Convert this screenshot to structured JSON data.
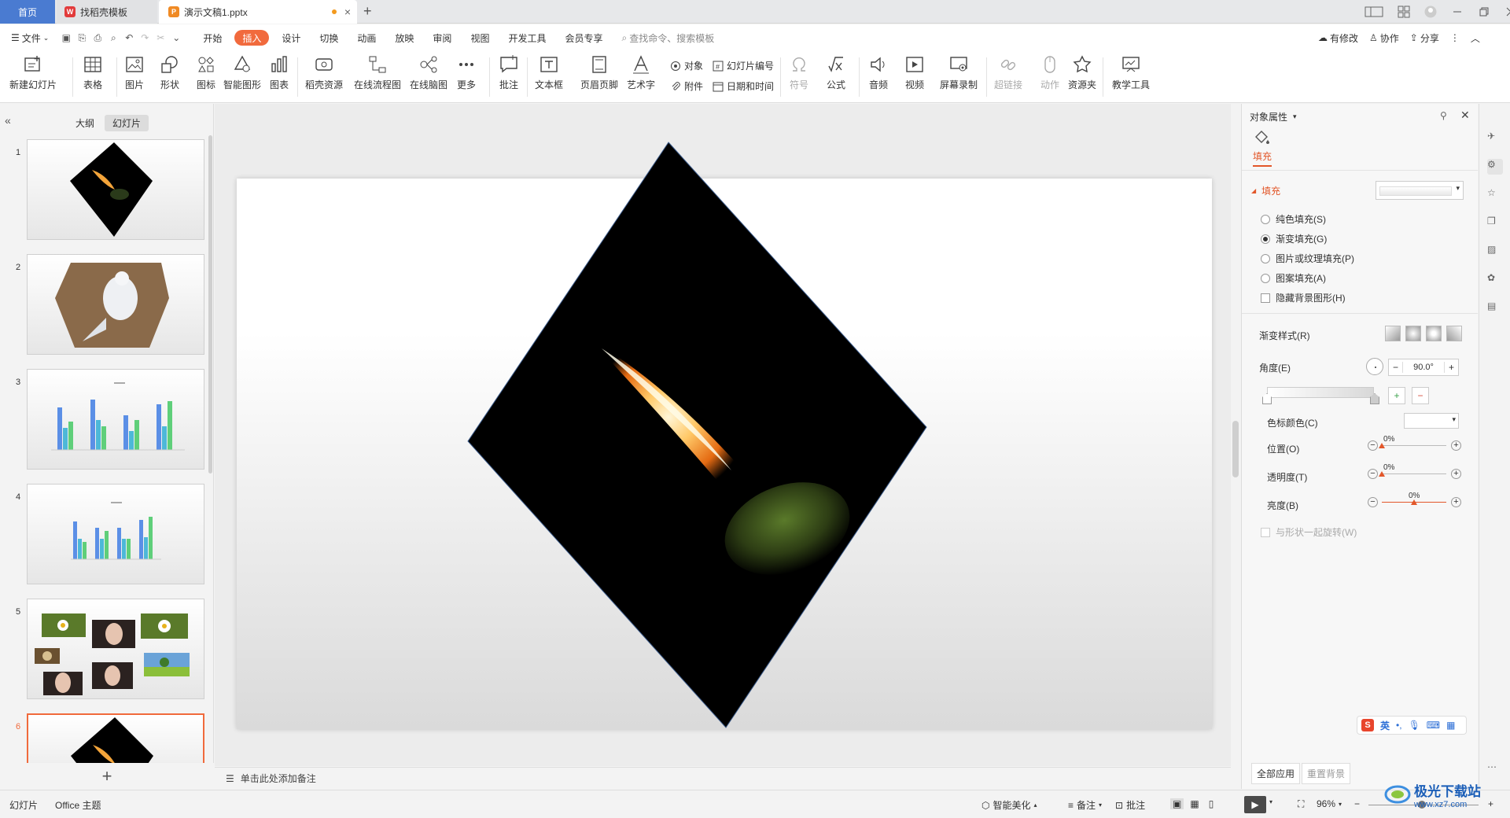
{
  "titlebar": {
    "tabs": [
      {
        "label": "首页"
      },
      {
        "label": "找稻壳模板"
      },
      {
        "label": "演示文稿1.pptx"
      }
    ]
  },
  "menubar": {
    "file": "文件",
    "items": [
      "开始",
      "插入",
      "设计",
      "切换",
      "动画",
      "放映",
      "审阅",
      "视图",
      "开发工具",
      "会员专享"
    ],
    "active": "插入",
    "search_placeholder": "查找命令、搜索模板",
    "right": {
      "modified": "有修改",
      "collab": "协作",
      "share": "分享"
    }
  },
  "ribbon": {
    "new_slide": "新建幻灯片",
    "table": "表格",
    "picture": "图片",
    "shape": "形状",
    "icon": "图标",
    "smartart": "智能图形",
    "chart": "图表",
    "docer": "稻壳资源",
    "flowchart": "在线流程图",
    "mindmap": "在线脑图",
    "more": "更多",
    "comment": "批注",
    "textbox": "文本框",
    "header_footer": "页眉页脚",
    "wordart": "艺术字",
    "object": "对象",
    "slide_number": "幻灯片编号",
    "attachment": "附件",
    "datetime": "日期和时间",
    "symbol": "符号",
    "formula": "公式",
    "audio": "音频",
    "video": "视频",
    "screen_record": "屏幕录制",
    "hyperlink": "超链接",
    "action": "动作",
    "resource": "资源夹",
    "teaching": "教学工具"
  },
  "leftpanel": {
    "tab_outline": "大纲",
    "tab_slides": "幻灯片",
    "slide_numbers": [
      "1",
      "2",
      "3",
      "4",
      "5",
      "6"
    ],
    "selected_slide": 6
  },
  "notes": {
    "placeholder": "单击此处添加备注"
  },
  "rightpanel": {
    "title": "对象属性",
    "tab_fill": "填充",
    "section_fill": "填充",
    "options": [
      "纯色填充(S)",
      "渐变填充(G)",
      "图片或纹理填充(P)",
      "图案填充(A)"
    ],
    "selected_option": 1,
    "hide_bg": "隐藏背景图形(H)",
    "gradient_style": "渐变样式(R)",
    "angle_label": "角度(E)",
    "angle_value": "90.0°",
    "stop_color": "色标颜色(C)",
    "position": "位置(O)",
    "position_value": "0%",
    "transparency": "透明度(T)",
    "transparency_value": "0%",
    "brightness": "亮度(B)",
    "brightness_value": "0%",
    "rotate_with_shape": "与形状一起旋转(W)",
    "apply_all": "全部应用",
    "reset_bg": "重置背景"
  },
  "ime": {
    "lang": "英"
  },
  "statusbar": {
    "slide": "幻灯片",
    "theme": "Office 主题",
    "beautify": "智能美化",
    "notes": "备注",
    "comments": "批注",
    "zoom": "96%"
  },
  "colors": {
    "accent": "#f16a3d",
    "home_tab": "#4a7bd1",
    "selected_thumb": "#f06a3c"
  },
  "watermark": {
    "text": "极光下载站",
    "url": "www.xz7.com"
  }
}
